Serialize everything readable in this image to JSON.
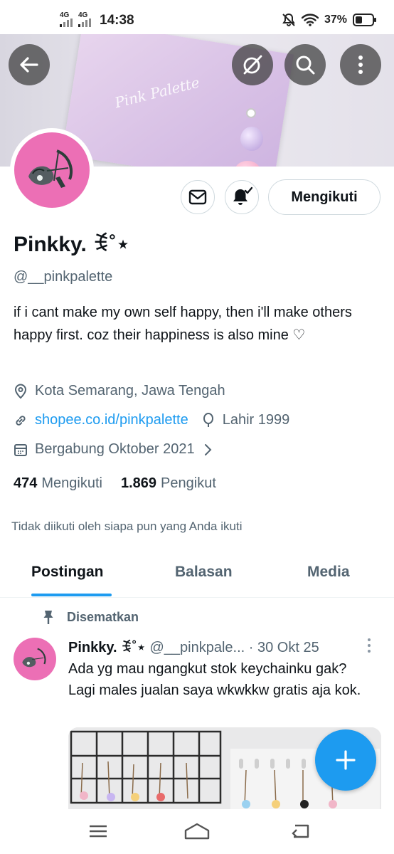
{
  "status_bar": {
    "signal_1": "4G",
    "signal_2": "4G",
    "time": "14:38",
    "battery": "37%"
  },
  "banner": {
    "text": "Pink Palette"
  },
  "profile": {
    "name": "Pinkky. ꉂ˚⋆",
    "handle": "@__pinkpalette",
    "follow_button": "Mengikuti",
    "bio": "if i cant make my own self happy, then i'll make others happy first. coz their happiness is also mine ♡",
    "location": "Kota Semarang, Jawa Tengah",
    "website": "shopee.co.id/pinkpalette",
    "birth": "Lahir 1999",
    "joined": "Bergabung Oktober 2021",
    "following_count": "474",
    "following_label": "Mengikuti",
    "followers_count": "1.869",
    "followers_label": "Pengikut",
    "followed_by": "Tidak diikuti oleh siapa pun yang Anda ikuti"
  },
  "tabs": [
    {
      "label": "Postingan"
    },
    {
      "label": "Balasan"
    },
    {
      "label": "Media"
    }
  ],
  "tweet": {
    "pinned_label": "Disematkan",
    "author": "Pinkky. ꉂ˚⋆",
    "handle": "@__pinkpale...",
    "date": "· 30 Okt 25",
    "text": "Ada yg mau ngangkut stok keychainku gak? Lagi males jualan saya wkwkkw gratis aja kok."
  },
  "colors": {
    "accent": "#1d9bf0",
    "avatar_pink": "#ec6fb5",
    "secondary_text": "#536471"
  }
}
